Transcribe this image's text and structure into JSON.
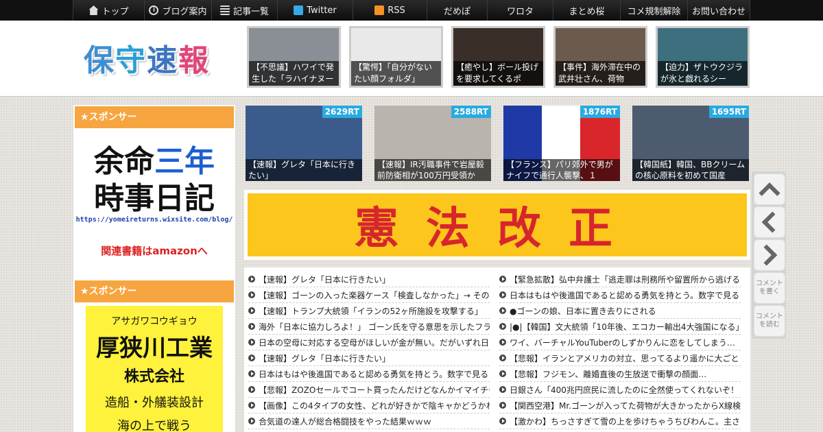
{
  "nav": [
    {
      "label": "トップ",
      "icon": "home-icon",
      "w": 104
    },
    {
      "label": "ブログ案内",
      "icon": "info-icon",
      "w": 98
    },
    {
      "label": "記事一覧",
      "icon": "list-icon",
      "w": 96
    },
    {
      "label": "Twitter",
      "icon": "twitter-icon",
      "w": 110
    },
    {
      "label": "RSS",
      "icon": "rss-icon",
      "w": 108
    },
    {
      "label": "だめぽ",
      "icon": "",
      "w": 88
    },
    {
      "label": "ワロタ",
      "icon": "",
      "w": 96
    },
    {
      "label": "まとめ桜",
      "icon": "",
      "w": 98
    },
    {
      "label": "コメ規制解除",
      "icon": "",
      "w": 98
    },
    {
      "label": "お問い合わせ",
      "icon": "",
      "w": 92
    }
  ],
  "logo": [
    "保",
    "守",
    "速",
    "報"
  ],
  "header_thumbs": [
    {
      "caption": "【不思議】ハワイで発生した「ラハイナヌーン」",
      "bg": "#8a8f95"
    },
    {
      "caption": "【驚愕】「自分がないたい顔フォルダ」",
      "bg": "#e9e9e9"
    },
    {
      "caption": "【癒やし】ボール投げを要求してくるポ",
      "bg": "#3a2f28"
    },
    {
      "caption": "【事件】海外滞在中の武井壮さん、荷物",
      "bg": "#6b5b4f"
    },
    {
      "caption": "【迫力】ザトウクジラが氷と戯れるシー",
      "bg": "#3e6f7e"
    }
  ],
  "sidebar": {
    "sponsor_label": "★スポンサー",
    "ad1": {
      "line1a": "余命",
      "line1b": "三年",
      "line2": "時事日記",
      "url": "https://yomeireturns.wixsite.com/blog/",
      "link": "関連書籍はamazonへ"
    },
    "sponsor_label2": "★スポンサー",
    "ad2": {
      "kana": "アサガワコウギョウ",
      "name": "厚狭川工業",
      "kk": "株式会社",
      "desc": "造船・外艤装設計",
      "more": "海の上で戦う"
    }
  },
  "rt_cards": [
    {
      "count": "2629RT",
      "caption": "【速報】グレタ「日本に行きたい」",
      "bg": "#3b5b8c"
    },
    {
      "count": "2588RT",
      "caption": "【速報】IR汚職事件で岩屋毅前防衛相が100万円受領か",
      "bg": "#b9b4ad"
    },
    {
      "count": "1876RT",
      "caption": "【フランス】パリ郊外で男がナイフで通行人襲撃、１",
      "bg": "#ffffff"
    },
    {
      "count": "1695RT",
      "caption": "【韓国紙】韓国、BBクリームの核心原料を初めて国産",
      "bg": "#4c5b70"
    }
  ],
  "banner": {
    "text": "憲法改正"
  },
  "news_left": [
    "【速報】グレタ「日本に行きたい」",
    "【速報】ゴーンの入った楽器ケース「検査しなかった」→ その",
    "【速報】トランプ大統領「イランの52ヶ所施設を攻撃する」",
    "海外「日本に協力しろよ！」 ゴーン氏を守る意思を示したフラ",
    "日本の空母に対応する空母がほしいが金が無い。だがいずれ日",
    "【速報】グレタ「日本に行きたい」",
    "日本はもはや後進国であると認める勇気を持とう。数字で見る",
    "【悲報】ZOZOセールでコート買ったんだけどなんかイマイチや",
    "【画像】この4タイプの女性、どれが好きかで陰キャかどうかわ",
    "合気道の達人が総合格闘技をやった結果ｗｗｗ"
  ],
  "news_right": [
    "【緊急拡散】弘中弁護士「逃走罪は刑務所や留置所から逃げる",
    "日本はもはや後進国であると認める勇気を持とう。数字で見る",
    "●ゴーンの娘、日本に置き去りにされる",
    "|●|【韓国】文大統領「10年後、エコカー輸出4大強国になる」",
    "ワイ、バーチャルYouTuberのしずかりんに恋をしてしまう…",
    "【悲報】イランとアメリカの対立、思ってるより遥かに大ごと",
    "【悲報】フジモン、離婚直後の生放送で衝撃の顔面…",
    "日銀さん「400兆円庶民に流したのに全然使ってくれないぞ！",
    "【関西空港】Mr.ゴーンが入ってた荷物が大きかったからX線検",
    "【激かわ】ちっさすぎて雪の上を歩けちゃうちびわんこ。主さ"
  ],
  "right_buttons": {
    "top": "",
    "prev": "",
    "next": "",
    "write_comment": "コメントを書く",
    "read_comment": "コメントを読む"
  }
}
